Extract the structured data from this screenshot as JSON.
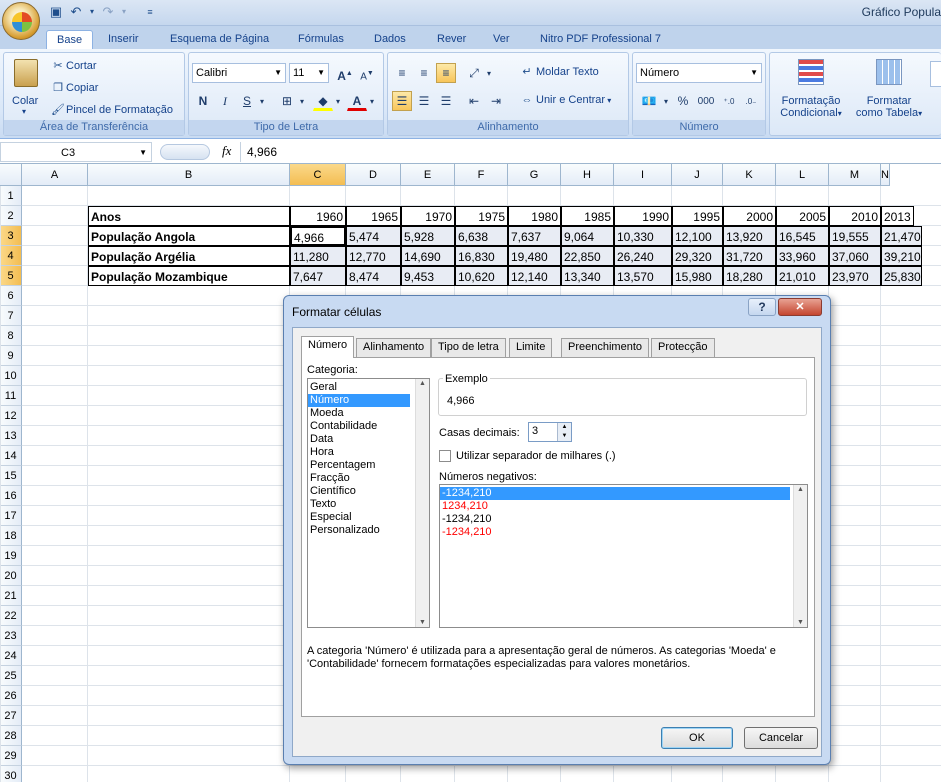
{
  "app": {
    "title": "Gráfico Popula"
  },
  "tabs": [
    "Base",
    "Inserir",
    "Esquema de Página",
    "Fórmulas",
    "Dados",
    "Rever",
    "Ver",
    "Nitro PDF Professional 7"
  ],
  "ribbon": {
    "clipboard": {
      "paste": "Colar",
      "cut": "Cortar",
      "copy": "Copiar",
      "format_painter": "Pincel de Formatação",
      "label": "Área de Transferência"
    },
    "font": {
      "name": "Calibri",
      "size": "11",
      "bold": "N",
      "italic": "I",
      "underline": "S",
      "label": "Tipo de Letra"
    },
    "alignment": {
      "wrap": "Moldar Texto",
      "merge": "Unir e Centrar",
      "label": "Alinhamento"
    },
    "number": {
      "format": "Número",
      "percent": "%",
      "thousands": "000",
      "label": "Número"
    },
    "styles": {
      "cond_format": "Formatação",
      "cond_format2": "Condicional",
      "table_format": "Formatar",
      "table_format2": "como Tabela"
    }
  },
  "formula_bar": {
    "name_box": "C3",
    "fx": "fx",
    "value": "4,966"
  },
  "sheet": {
    "columns": [
      "A",
      "B",
      "C",
      "D",
      "E",
      "F",
      "G",
      "H",
      "I",
      "J",
      "K",
      "L",
      "M",
      "N"
    ],
    "rows": [
      "1",
      "2",
      "3",
      "4",
      "5",
      "6",
      "7",
      "8",
      "9",
      "10",
      "11",
      "12",
      "13",
      "14",
      "15",
      "16",
      "17",
      "18",
      "19",
      "20",
      "21",
      "22",
      "23",
      "24",
      "25",
      "26",
      "27",
      "28",
      "29",
      "30"
    ],
    "header_label": "Anos",
    "years": [
      "1960",
      "1965",
      "1970",
      "1975",
      "1980",
      "1985",
      "1990",
      "1995",
      "2000",
      "2005",
      "2010",
      "2013"
    ],
    "data": [
      {
        "label": "População Angola",
        "values": [
          "4,966",
          "5,474",
          "5,928",
          "6,638",
          "7,637",
          "9,064",
          "10,330",
          "12,100",
          "13,920",
          "16,545",
          "19,555",
          "21,470"
        ]
      },
      {
        "label": "População Argélia",
        "values": [
          "11,280",
          "12,770",
          "14,690",
          "16,830",
          "19,480",
          "22,850",
          "26,240",
          "29,320",
          "31,720",
          "33,960",
          "37,060",
          "39,210"
        ]
      },
      {
        "label": "População Mozambique",
        "values": [
          "7,647",
          "8,474",
          "9,453",
          "10,620",
          "12,140",
          "13,340",
          "13,570",
          "15,980",
          "18,280",
          "21,010",
          "23,970",
          "25,830"
        ]
      }
    ]
  },
  "dialog": {
    "title": "Formatar células",
    "help": "?",
    "close": "✕",
    "tabs": [
      "Número",
      "Alinhamento",
      "Tipo de letra",
      "Limite",
      "Preenchimento",
      "Protecção"
    ],
    "category_label": "Categoria:",
    "categories": [
      "Geral",
      "Número",
      "Moeda",
      "Contabilidade",
      "Data",
      "Hora",
      "Percentagem",
      "Fracção",
      "Científico",
      "Texto",
      "Especial",
      "Personalizado"
    ],
    "sample_label": "Exemplo",
    "sample_value": "4,966",
    "decimals_label": "Casas decimais:",
    "decimals_value": "3",
    "thousands_label": "Utilizar separador de milhares (.)",
    "negatives_label": "Números negativos:",
    "negatives": [
      {
        "text": "-1234,210",
        "color": "#000000"
      },
      {
        "text": "1234,210",
        "color": "#ff0000"
      },
      {
        "text": "-1234,210",
        "color": "#000000"
      },
      {
        "text": "-1234,210",
        "color": "#ff0000"
      }
    ],
    "description": "A categoria 'Número' é utilizada para a apresentação geral de números. As categorias 'Moeda' e 'Contabilidade' fornecem formatações especializadas para valores monetários.",
    "ok": "OK",
    "cancel": "Cancelar"
  },
  "colors": {
    "accent": "#15428b",
    "selection": "#3399ff",
    "header_sel": "#f3bd52"
  }
}
